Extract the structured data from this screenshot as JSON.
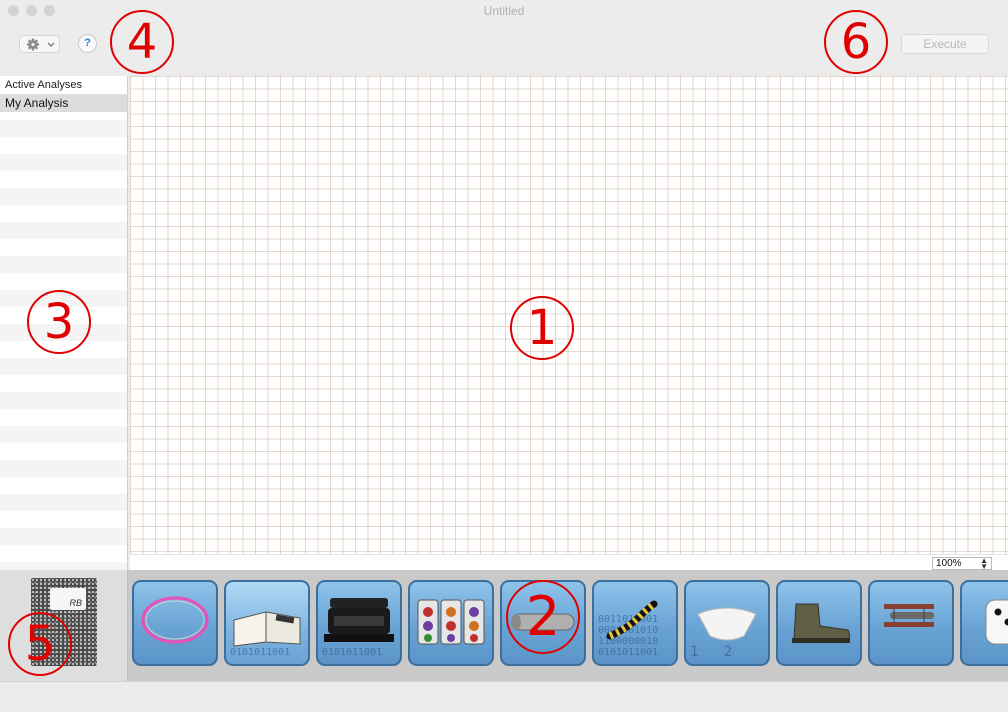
{
  "window": {
    "title": "Untitled"
  },
  "toolbar": {
    "help_label": "?",
    "execute_label": "Execute"
  },
  "sidebar": {
    "header": "Active Analyses",
    "items": [
      {
        "label": "My Analysis"
      }
    ]
  },
  "canvas": {
    "zoom": "100%"
  },
  "notebook": {
    "label": "RB"
  },
  "tools": [
    {
      "icon": "loop-icon"
    },
    {
      "icon": "open-book-icon",
      "binary": "0101011001"
    },
    {
      "icon": "typewriter-icon",
      "binary": "0101011001"
    },
    {
      "icon": "slot-machine-icon"
    },
    {
      "icon": "pipe-icon"
    },
    {
      "icon": "caterpillar-icon",
      "binary": "0011010001\n0000001010\n1100000010\n0101011001"
    },
    {
      "icon": "coffee-filter-icon",
      "binary": "1   2"
    },
    {
      "icon": "boot-icon"
    },
    {
      "icon": "biplane-icon"
    },
    {
      "icon": "dice-icon"
    }
  ],
  "annotations": [
    "1",
    "2",
    "3",
    "4",
    "5",
    "6"
  ],
  "colors": {
    "annotation": "#e00000",
    "tile_border": "#3b6f9e",
    "tile_fill": "#7fb4e0"
  }
}
